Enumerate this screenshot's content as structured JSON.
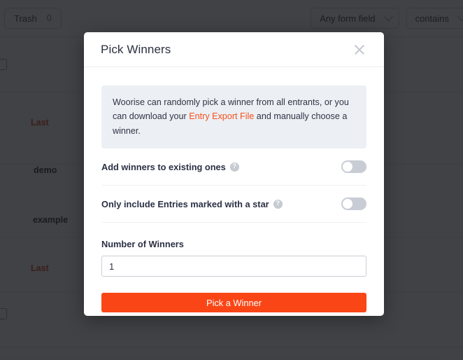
{
  "background": {
    "toolbar": {
      "trash_label": "Trash",
      "trash_count": "0",
      "field_select": "Any form field",
      "operator_select": "contains"
    },
    "table_cells": [
      {
        "text": "Last",
        "tone": "orange"
      },
      {
        "text": "demo",
        "tone": "dark"
      },
      {
        "text": "example",
        "tone": "dark"
      },
      {
        "text": "Last",
        "tone": "orange"
      }
    ]
  },
  "modal": {
    "title": "Pick Winners",
    "close_icon": "close-icon",
    "info": {
      "text_before": "Woorise can randomly pick a winner from all entrants, or you can download your ",
      "link": "Entry Export File",
      "text_after": " and manually choose a winner."
    },
    "toggles": [
      {
        "label": "Add winners to existing ones",
        "help_icon": "?",
        "state": "off"
      },
      {
        "label": "Only include Entries marked with a star",
        "help_icon": "?",
        "state": "off"
      }
    ],
    "number_field": {
      "label": "Number of Winners",
      "value": "1",
      "placeholder": "1"
    },
    "submit_label": "Pick a Winner"
  },
  "colors": {
    "accent": "#fa4616",
    "link": "#f4511e",
    "info_bg": "#eceff3",
    "toggle_track": "#c8ccd4"
  }
}
